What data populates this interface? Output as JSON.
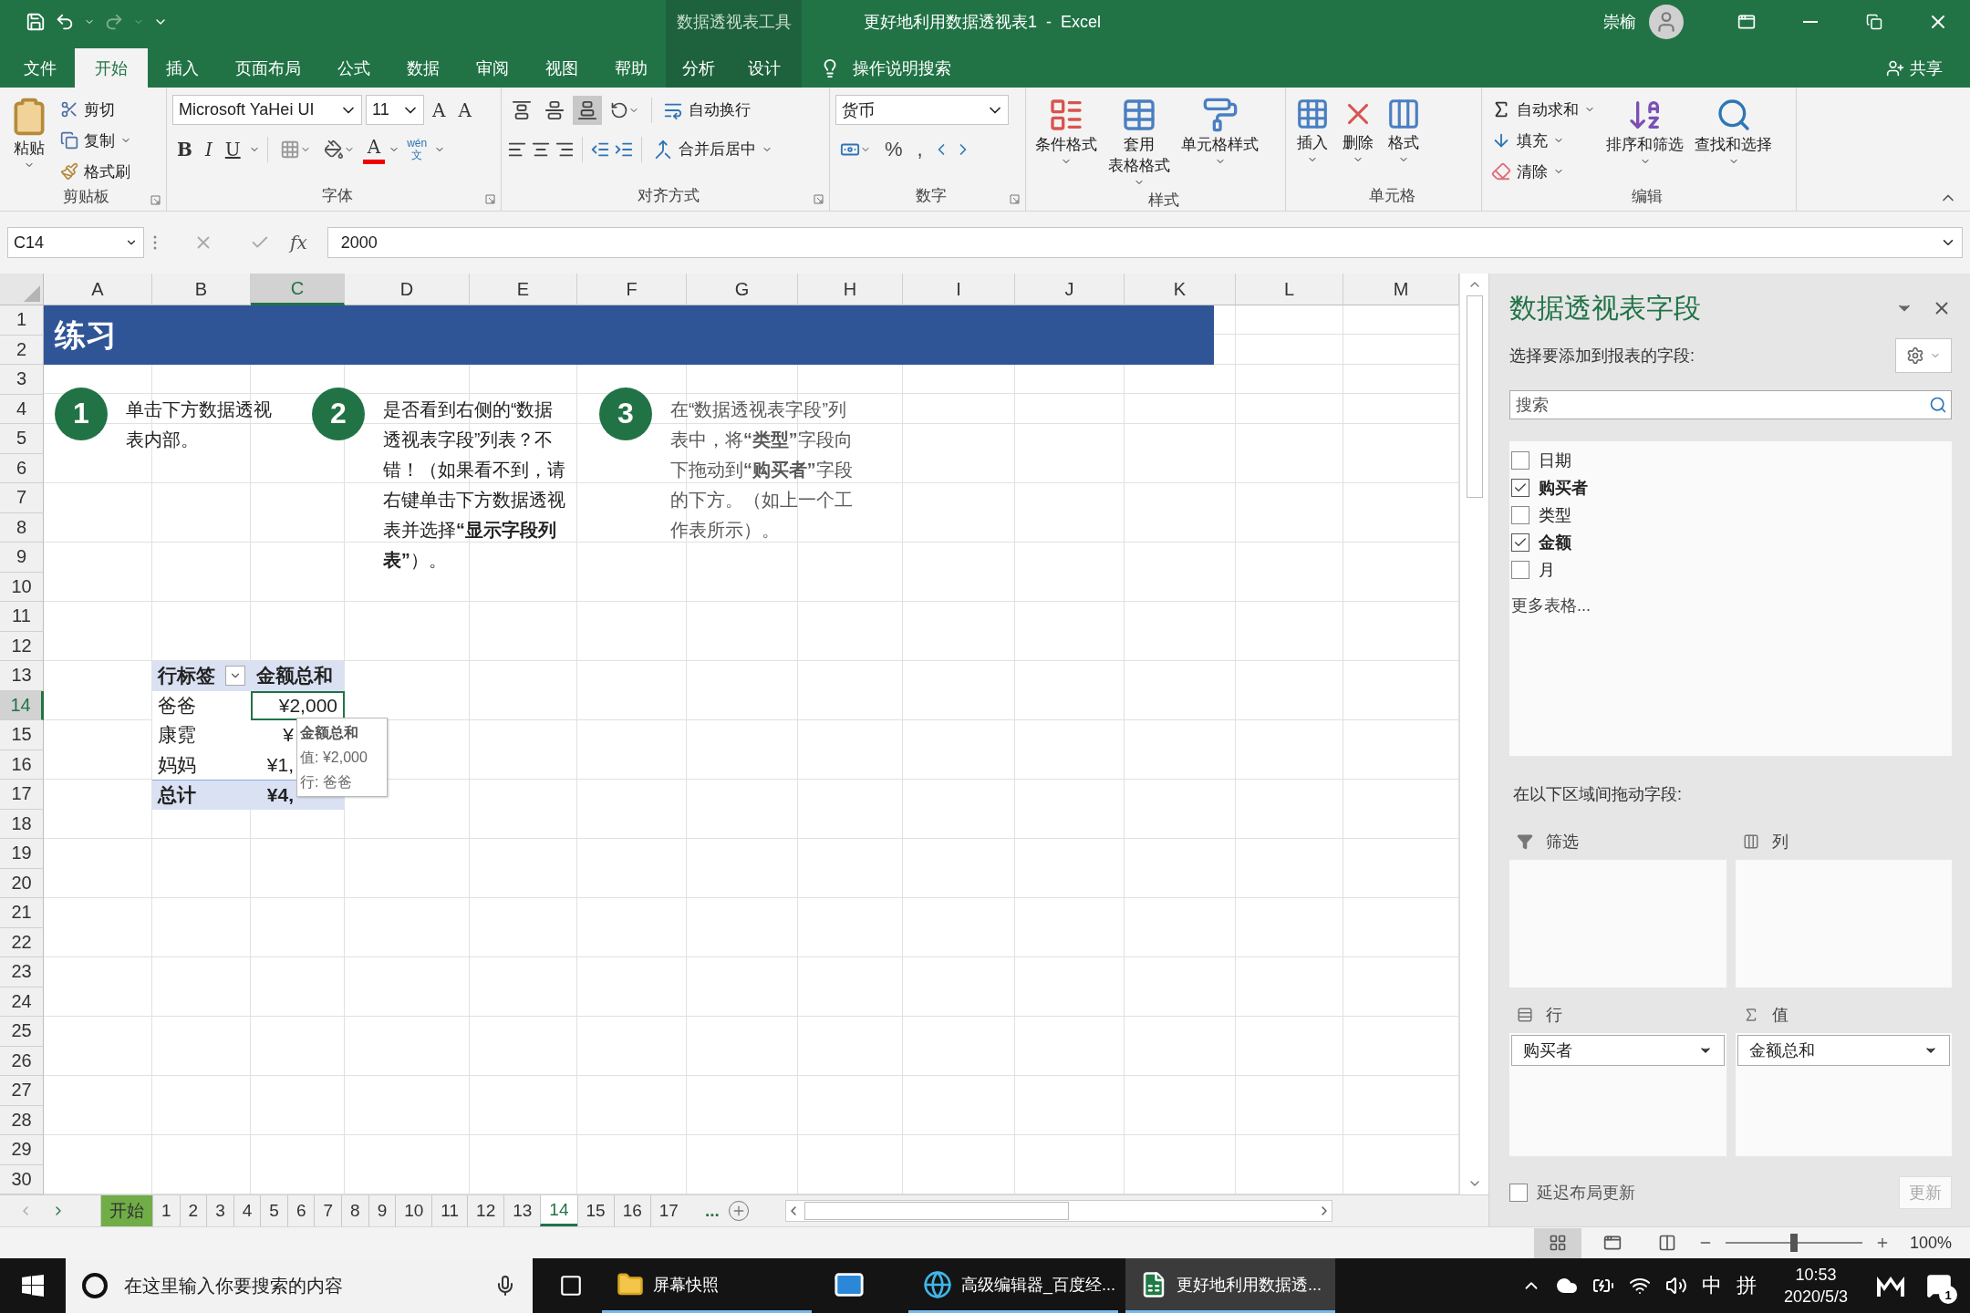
{
  "title_bar": {
    "context_tool": "数据透视表工具",
    "title": "更好地利用数据透视表1  -  Excel",
    "user": "崇榆"
  },
  "ribbon_tabs": [
    {
      "label": "文件",
      "kind": "normal",
      "selected": false
    },
    {
      "label": "开始",
      "kind": "normal",
      "selected": true
    },
    {
      "label": "插入",
      "kind": "normal",
      "selected": false
    },
    {
      "label": "页面布局",
      "kind": "normal",
      "selected": false
    },
    {
      "label": "公式",
      "kind": "normal",
      "selected": false
    },
    {
      "label": "数据",
      "kind": "normal",
      "selected": false
    },
    {
      "label": "审阅",
      "kind": "normal",
      "selected": false
    },
    {
      "label": "视图",
      "kind": "normal",
      "selected": false
    },
    {
      "label": "帮助",
      "kind": "normal",
      "selected": false
    },
    {
      "label": "分析",
      "kind": "context",
      "selected": false
    },
    {
      "label": "设计",
      "kind": "context",
      "selected": false
    }
  ],
  "tell_me": "操作说明搜索",
  "share": "共享",
  "ribbon": {
    "clipboard": {
      "label": "剪贴板",
      "paste": "粘贴",
      "cut": "剪切",
      "copy": "复制",
      "format_painter": "格式刷"
    },
    "font": {
      "label": "字体",
      "font_name": "Microsoft YaHei UI",
      "font_size": "11",
      "grow": "A",
      "shrink": "A",
      "bold": "B",
      "italic": "I",
      "underline": "U",
      "font_color": "A",
      "phonetic": "wén",
      "phonetic_char": "文"
    },
    "alignment": {
      "label": "对齐方式",
      "vertical": [
        {
          "kind": "top",
          "selected": false
        },
        {
          "kind": "middle",
          "selected": false
        },
        {
          "kind": "bottom",
          "selected": true
        }
      ],
      "wrap_text": "自动换行",
      "merge_center": "合并后居中"
    },
    "number": {
      "label": "数字",
      "format": "货币",
      "percent": "%",
      "comma": ","
    },
    "styles": {
      "label": "样式",
      "buttons": [
        {
          "kind": "conditional",
          "lines": [
            "条件格式"
          ]
        },
        {
          "kind": "table",
          "lines": [
            "套用",
            "表格格式"
          ]
        },
        {
          "kind": "cell",
          "lines": [
            "单元格样式"
          ]
        }
      ]
    },
    "cells": {
      "label": "单元格",
      "buttons": [
        {
          "kind": "insert",
          "label": "插入"
        },
        {
          "kind": "delete",
          "label": "删除"
        },
        {
          "kind": "format",
          "label": "格式"
        }
      ]
    },
    "editing": {
      "label": "编辑",
      "small": [
        {
          "kind": "sum",
          "label": "自动求和"
        },
        {
          "kind": "fill",
          "label": "填充"
        },
        {
          "kind": "clear",
          "label": "清除"
        }
      ],
      "sort_filter": "排序和筛选",
      "find_select": "查找和选择"
    }
  },
  "formula_bar": {
    "name_box": "C14",
    "fx": "fx",
    "value": "2000"
  },
  "sheet": {
    "columns": [
      {
        "label": "A",
        "selected": false
      },
      {
        "label": "B",
        "selected": false
      },
      {
        "label": "C",
        "selected": true
      },
      {
        "label": "D",
        "selected": false
      },
      {
        "label": "E",
        "selected": false
      },
      {
        "label": "F",
        "selected": false
      },
      {
        "label": "G",
        "selected": false
      },
      {
        "label": "H",
        "selected": false
      },
      {
        "label": "I",
        "selected": false
      },
      {
        "label": "J",
        "selected": false
      },
      {
        "label": "K",
        "selected": false
      },
      {
        "label": "L",
        "selected": false
      },
      {
        "label": "M",
        "selected": false
      }
    ],
    "rows": [
      {
        "label": "1",
        "selected": false
      },
      {
        "label": "2",
        "selected": false
      },
      {
        "label": "3",
        "selected": false
      },
      {
        "label": "4",
        "selected": false
      },
      {
        "label": "5",
        "selected": false
      },
      {
        "label": "6",
        "selected": false
      },
      {
        "label": "7",
        "selected": false
      },
      {
        "label": "8",
        "selected": false
      },
      {
        "label": "9",
        "selected": false
      },
      {
        "label": "10",
        "selected": false
      },
      {
        "label": "11",
        "selected": false
      },
      {
        "label": "12",
        "selected": false
      },
      {
        "label": "13",
        "selected": false
      },
      {
        "label": "14",
        "selected": true
      },
      {
        "label": "15",
        "selected": false
      },
      {
        "label": "16",
        "selected": false
      },
      {
        "label": "17",
        "selected": false
      },
      {
        "label": "18",
        "selected": false
      },
      {
        "label": "19",
        "selected": false
      },
      {
        "label": "20",
        "selected": false
      },
      {
        "label": "21",
        "selected": false
      },
      {
        "label": "22",
        "selected": false
      },
      {
        "label": "23",
        "selected": false
      },
      {
        "label": "24",
        "selected": false
      },
      {
        "label": "25",
        "selected": false
      },
      {
        "label": "26",
        "selected": false
      },
      {
        "label": "27",
        "selected": false
      },
      {
        "label": "28",
        "selected": false
      },
      {
        "label": "29",
        "selected": false
      },
      {
        "label": "30",
        "selected": false
      }
    ],
    "banner": "练习",
    "steps": [
      {
        "number": "1",
        "text": "单击下方数据透视表内部。"
      },
      {
        "number": "2",
        "text": "是否看到右侧的“数据透视表字段”列表？不错！（如果看不到，请右键单击下方数据透视表并选择**“显示字段列表”**）。"
      },
      {
        "number": "3",
        "text": "在“数据透视表字段”列表中，将**“类型”**字段向下拖动到**“购买者”**字段的下方。（如上一个工作表所示）。"
      }
    ],
    "pivot": {
      "headers": [
        "行标签",
        "金额总和"
      ],
      "rows": [
        {
          "label": "爸爸",
          "value": "¥2,000",
          "selected": true
        },
        {
          "label": "康霓",
          "value": "¥",
          "selected": false
        },
        {
          "label": "妈妈",
          "value": "¥1,",
          "selected": false
        }
      ],
      "total": {
        "label": "总计",
        "value": "¥4,"
      }
    },
    "tooltip": {
      "title": "金额总和",
      "lines": [
        "值: ¥2,000",
        "行: 爸爸"
      ]
    }
  },
  "sheet_tabs": {
    "tabs": [
      {
        "label": "开始",
        "selected": false,
        "color": "#70ad47"
      },
      {
        "label": "1",
        "selected": false
      },
      {
        "label": "2",
        "selected": false
      },
      {
        "label": "3",
        "selected": false
      },
      {
        "label": "4",
        "selected": false
      },
      {
        "label": "5",
        "selected": false
      },
      {
        "label": "6",
        "selected": false
      },
      {
        "label": "7",
        "selected": false
      },
      {
        "label": "8",
        "selected": false
      },
      {
        "label": "9",
        "selected": false
      },
      {
        "label": "10",
        "selected": false
      },
      {
        "label": "11",
        "selected": false
      },
      {
        "label": "12",
        "selected": false
      },
      {
        "label": "13",
        "selected": false
      },
      {
        "label": "14",
        "selected": true
      },
      {
        "label": "15",
        "selected": false
      },
      {
        "label": "16",
        "selected": false
      },
      {
        "label": "17",
        "selected": false
      }
    ],
    "more": "..."
  },
  "pane": {
    "title": "数据透视表字段",
    "prompt": "选择要添加到报表的字段:",
    "search_placeholder": "搜索",
    "fields": [
      {
        "label": "日期",
        "checked": false
      },
      {
        "label": "购买者",
        "checked": true
      },
      {
        "label": "类型",
        "checked": false
      },
      {
        "label": "金额",
        "checked": true
      },
      {
        "label": "月",
        "checked": false
      }
    ],
    "more_tables": "更多表格...",
    "areas_prompt": "在以下区域间拖动字段:",
    "areas": [
      {
        "label": "筛选",
        "kind": "filter"
      },
      {
        "label": "列",
        "kind": "columns"
      },
      {
        "label": "行",
        "kind": "rows",
        "items": [
          "购买者"
        ]
      },
      {
        "label": "值",
        "kind": "values",
        "items": [
          "金额总和"
        ]
      }
    ],
    "defer_update": {
      "label": "延迟布局更新",
      "checked": false
    },
    "update_button": {
      "label": "更新",
      "disabled": true
    }
  },
  "status_bar": {
    "views": [
      {
        "kind": "normal",
        "selected": true
      },
      {
        "kind": "page_layout",
        "selected": false
      },
      {
        "kind": "page_break",
        "selected": false
      }
    ],
    "zoom": {
      "level": 0.5,
      "label": "100%"
    }
  },
  "taskbar": {
    "search_placeholder": "在这里输入你要搜索的内容",
    "apps": [
      {
        "kind": "folder",
        "label": "屏幕快照",
        "running": true,
        "selected": false
      },
      {
        "kind": "mail",
        "running": false,
        "selected": false
      },
      {
        "kind": "edge",
        "label": "高级编辑器_百度经...",
        "running": true,
        "selected": false
      },
      {
        "kind": "excel",
        "label": "更好地利用数据透...",
        "running": true,
        "selected": true
      }
    ],
    "ime": [
      "中",
      "拼"
    ],
    "time": "10:53",
    "date": "2020/5/3",
    "notifications": "1"
  }
}
